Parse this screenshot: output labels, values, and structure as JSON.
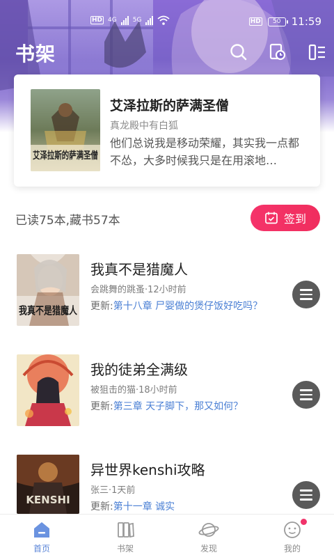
{
  "status_bar": {
    "hd1": "HD",
    "hd2": "HD",
    "net1": "4G",
    "net2": "5G",
    "battery": "50",
    "time": "11:59"
  },
  "header": {
    "title": "书架",
    "icons": [
      "search-icon",
      "history-icon",
      "list-icon"
    ]
  },
  "featured": {
    "title": "艾泽拉斯的萨满圣僧",
    "author": "真龙殿中有白狐",
    "description": "他们总说我是移动荣耀，其实我一点都不怂，大多时候我只是在用滚地…",
    "cover_text": "艾泽拉斯的萨满圣僧"
  },
  "stats": {
    "text": "已读75本,藏书57本",
    "signin_label": "签到"
  },
  "books": [
    {
      "title": "我真不是猎魔人",
      "meta": "会跳舞的跳蚤·12小时前",
      "update_prefix": "更新:",
      "chapter": "第十八章 尸婴做的煲仔饭好吃吗？",
      "cover_text": "我真不是猎魔人"
    },
    {
      "title": "我的徒弟全满级",
      "meta": "被狙击的猫·18小时前",
      "update_prefix": "更新:",
      "chapter": "第三章 天子脚下，那又如何？",
      "cover_text": ""
    },
    {
      "title": "异世界kenshi攻略",
      "meta": "张三·1天前",
      "update_prefix": "更新:",
      "chapter": "第十一章 诚实",
      "cover_text": "KENSHI"
    }
  ],
  "nav": {
    "items": [
      {
        "label": "首页",
        "icon": "home-icon",
        "active": true
      },
      {
        "label": "书架",
        "icon": "bookshelf-icon",
        "active": false
      },
      {
        "label": "发现",
        "icon": "planet-icon",
        "active": false
      },
      {
        "label": "我的",
        "icon": "profile-icon",
        "active": false
      }
    ]
  },
  "colors": {
    "accent": "#f0336a",
    "link": "#4a7fd4",
    "header": "#7a63c9"
  }
}
